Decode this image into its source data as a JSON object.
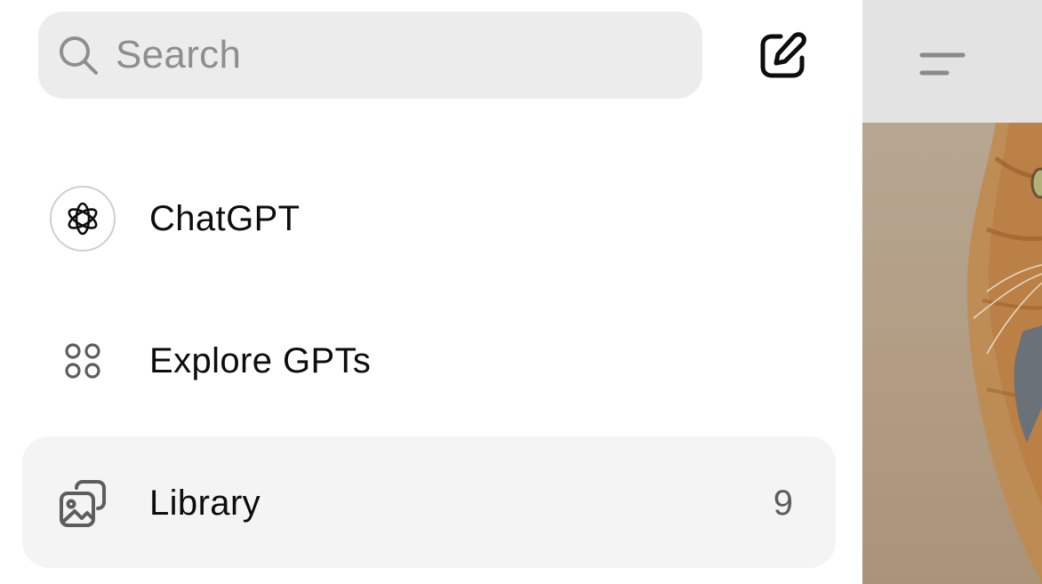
{
  "search": {
    "placeholder": "Search"
  },
  "compose": {
    "icon": "compose-icon"
  },
  "nav": {
    "items": [
      {
        "label": "ChatGPT",
        "icon": "chatgpt-logo-icon",
        "count": ""
      },
      {
        "label": "Explore GPTs",
        "icon": "explore-grid-icon",
        "count": ""
      },
      {
        "label": "Library",
        "icon": "library-images-icon",
        "count": "9"
      }
    ]
  },
  "content": {
    "menu_icon": "menu-icon",
    "image_alt": "cat-photo"
  },
  "colors": {
    "search_bg": "#ececec",
    "active_item_bg": "#f4f4f4",
    "text": "#0d0d0d",
    "muted": "#8e8e8e",
    "overlay_header": "#e3e3e3"
  }
}
